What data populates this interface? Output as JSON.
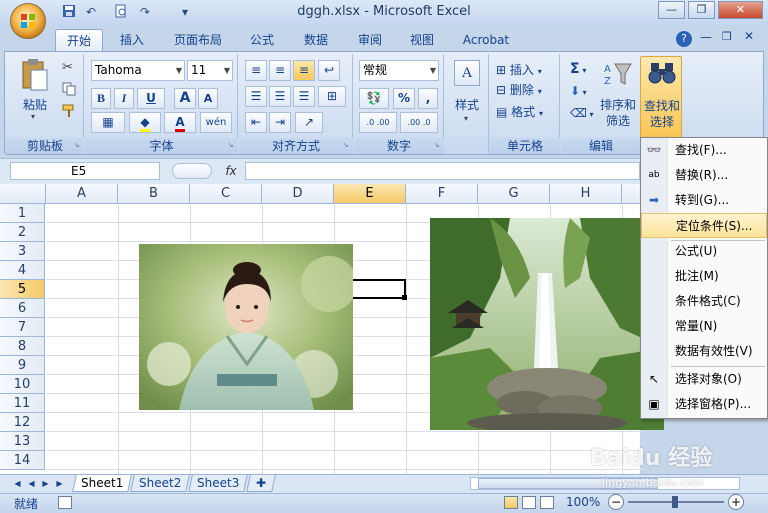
{
  "window": {
    "title": "dggh.xlsx - Microsoft Excel"
  },
  "tabs": [
    {
      "label": "开始",
      "active": true
    },
    {
      "label": "插入"
    },
    {
      "label": "页面布局"
    },
    {
      "label": "公式"
    },
    {
      "label": "数据"
    },
    {
      "label": "审阅"
    },
    {
      "label": "视图"
    },
    {
      "label": "Acrobat"
    }
  ],
  "ribbon": {
    "clipboard": {
      "label": "剪贴板",
      "paste": "粘贴"
    },
    "font": {
      "label": "字体",
      "name": "Tahoma",
      "size": "11",
      "bold": "B",
      "italic": "I",
      "underline": "U",
      "grow": "A",
      "shrink": "A",
      "color_letter": "A",
      "phonetic": "wén"
    },
    "alignment": {
      "label": "对齐方式"
    },
    "number": {
      "label": "数字",
      "format": "常规",
      "percent": "%",
      "comma": ",",
      "inc_dec": ".0 .00",
      "dec_dec": ".00 .0"
    },
    "styles": {
      "label": "样式"
    },
    "cells": {
      "label": "单元格",
      "insert": "插入",
      "delete": "删除",
      "format": "格式"
    },
    "editing": {
      "label": "编辑",
      "sum": "Σ",
      "sort_filter_1": "排序和",
      "sort_filter_2": "筛选",
      "find_select_1": "查找和",
      "find_select_2": "选择"
    }
  },
  "formula_bar": {
    "namebox": "E5",
    "fx": "fx",
    "value": ""
  },
  "grid": {
    "columns": [
      "A",
      "B",
      "C",
      "D",
      "E",
      "F",
      "G",
      "H"
    ],
    "rows": [
      "1",
      "2",
      "3",
      "4",
      "5",
      "6",
      "7",
      "8",
      "9",
      "10",
      "11",
      "12",
      "13",
      "14"
    ],
    "selected_col": "E",
    "selected_row": "5"
  },
  "sheets": [
    {
      "name": "Sheet1",
      "active": true
    },
    {
      "name": "Sheet2"
    },
    {
      "name": "Sheet3"
    }
  ],
  "status": {
    "ready": "就绪",
    "zoom": "100%",
    "minus": "−",
    "plus": "+"
  },
  "menu": {
    "items": [
      {
        "label": "查找(F)...",
        "icon": "binoculars-icon"
      },
      {
        "label": "替换(R)...",
        "icon": "replace-icon"
      },
      {
        "label": "转到(G)...",
        "icon": "arrow-right-icon"
      },
      {
        "label": "定位条件(S)...",
        "icon": "",
        "highlighted": true
      },
      {
        "label": "公式(U)",
        "icon": ""
      },
      {
        "label": "批注(M)",
        "icon": ""
      },
      {
        "label": "条件格式(C)",
        "icon": ""
      },
      {
        "label": "常量(N)",
        "icon": ""
      },
      {
        "label": "数据有效性(V)",
        "icon": ""
      },
      {
        "label": "选择对象(O)",
        "icon": "cursor-icon"
      },
      {
        "label": "选择窗格(P)...",
        "icon": "selection-pane-icon"
      }
    ]
  },
  "watermark": {
    "text": "Baidu 经验",
    "url": "jingyan.baidu.com"
  },
  "colors": {
    "accent": "#15428b",
    "ribbon_bg": "#dbe7f5",
    "selection": "#f6c967",
    "highlight": "#fde39a"
  }
}
